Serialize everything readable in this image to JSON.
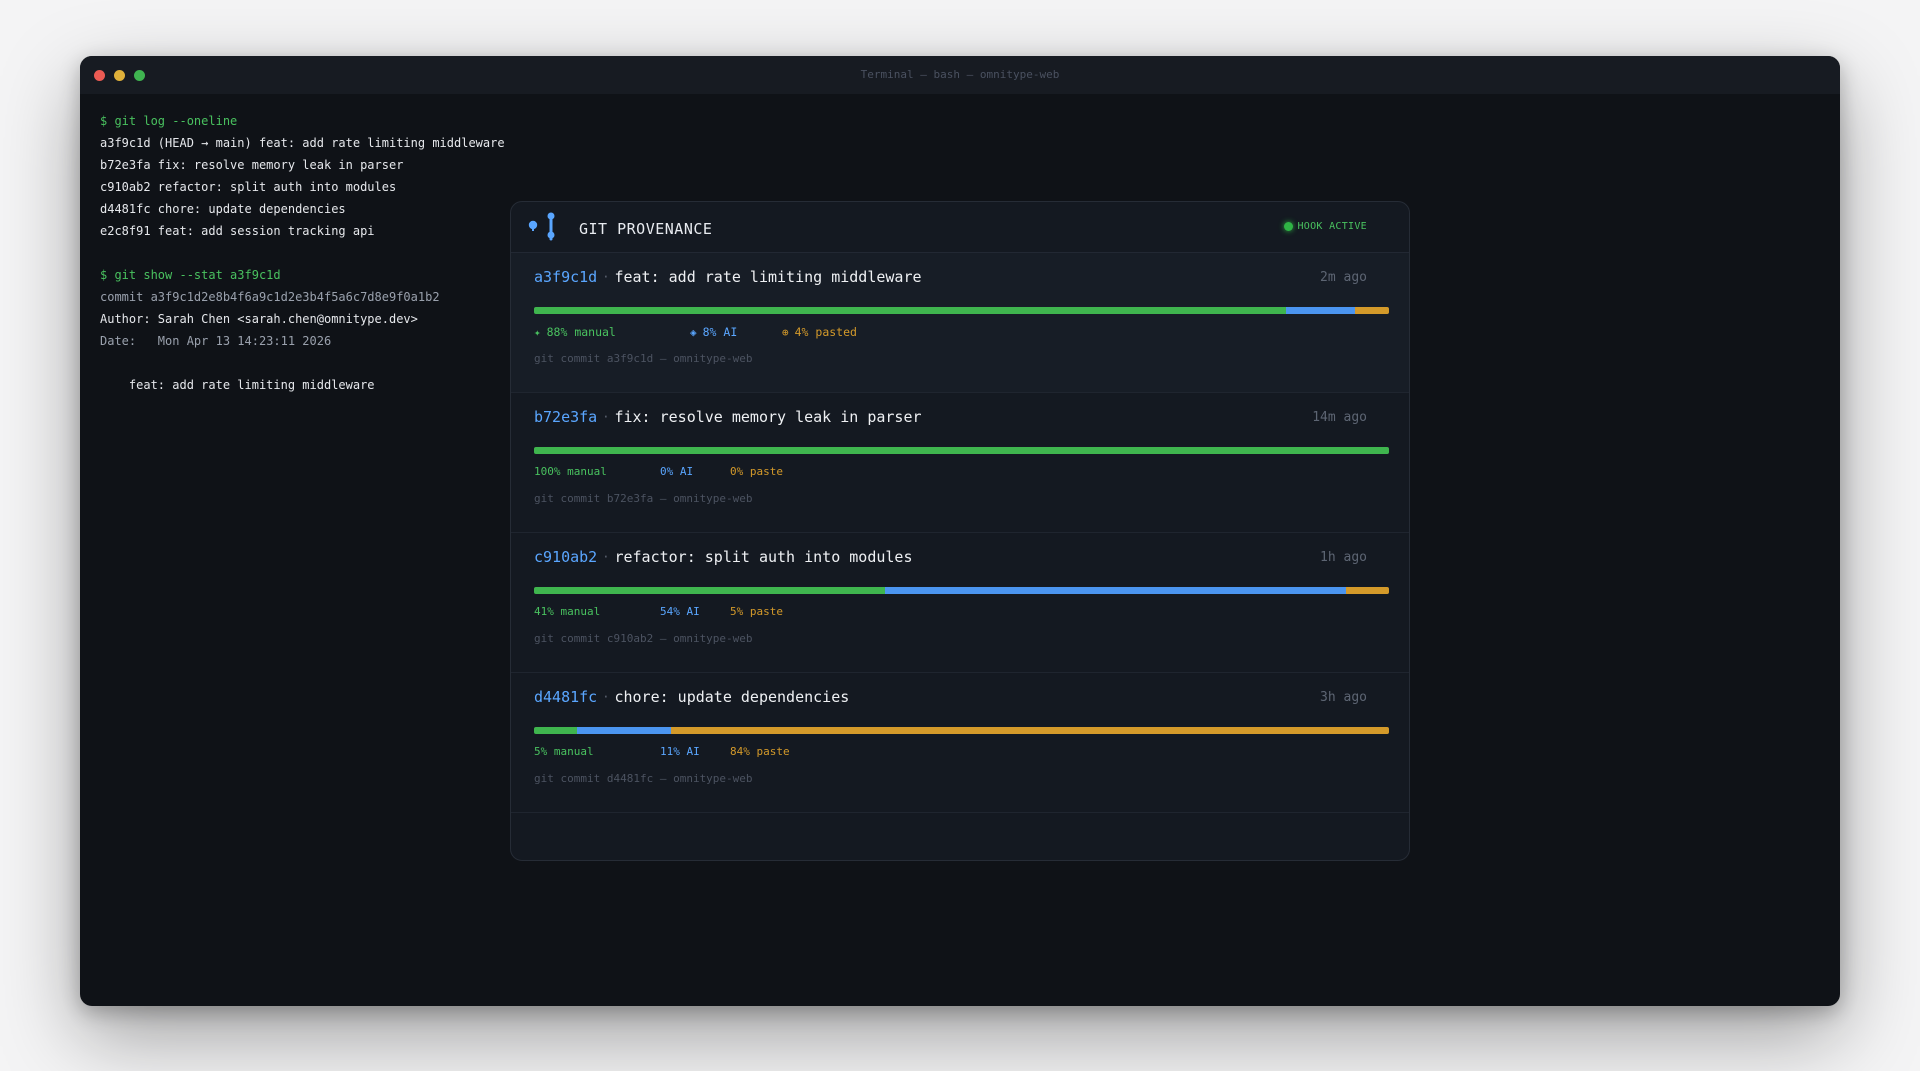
{
  "window": {
    "title": "Terminal — bash — omnitype-web"
  },
  "terminal": {
    "lines": [
      {
        "text": "$ git log --oneline",
        "kind": "prompt"
      },
      {
        "text": "a3f9c1d (HEAD → main) feat: add rate limiting middleware",
        "kind": "out"
      },
      {
        "text": "b72e3fa fix: resolve memory leak in parser",
        "kind": "out"
      },
      {
        "text": "c910ab2 refactor: split auth into modules",
        "kind": "out"
      },
      {
        "text": "d4481fc chore: update dependencies",
        "kind": "out"
      },
      {
        "text": "e2c8f91 feat: add session tracking api",
        "kind": "out"
      },
      {
        "text": "",
        "kind": "blank"
      },
      {
        "text": "$ git show --stat a3f9c1d",
        "kind": "prompt"
      },
      {
        "text": "commit a3f9c1d2e8b4f6a9c1d2e3b4f5a6c7d8e9f0a1b2",
        "kind": "dim"
      },
      {
        "text": "Author: Sarah Chen <sarah.chen@omnitype.dev>",
        "kind": "out"
      },
      {
        "text": "Date:   Mon Apr 13 14:23:11 2026",
        "kind": "dim"
      },
      {
        "text": "",
        "kind": "blank"
      },
      {
        "text": "    feat: add rate limiting middleware",
        "kind": "out"
      }
    ]
  },
  "panel": {
    "title": "GIT PROVENANCE",
    "hook_status": "HOOK ACTIVE",
    "icons": {
      "logo": "git-branch-icon",
      "hook": "status-dot-icon"
    },
    "colors": {
      "manual": "#3fb54e",
      "ai": "#4b95f0",
      "paste": "#d49a2a",
      "hash": "#5aa6ff"
    },
    "commits": [
      {
        "hash": "a3f9c1d",
        "separator": "·",
        "message": "feat: add rate limiting middleware",
        "time": "2m ago",
        "manual": 88,
        "ai": 8,
        "paste": 4,
        "manual_label": "88% manual",
        "ai_label": "8% AI",
        "paste_label": "4% pasted",
        "manual_icon": "✦",
        "ai_icon": "◈",
        "paste_icon": "⊕",
        "command": "git commit a3f9c1d — omnitype-web",
        "selected": true
      },
      {
        "hash": "b72e3fa",
        "separator": "·",
        "message": "fix: resolve memory leak in parser",
        "time": "14m ago",
        "manual": 100,
        "ai": 0,
        "paste": 0,
        "manual_label": "100% manual",
        "ai_label": "0% AI",
        "paste_label": "0% paste",
        "command": "git commit b72e3fa — omnitype-web",
        "selected": false
      },
      {
        "hash": "c910ab2",
        "separator": "·",
        "message": "refactor: split auth into modules",
        "time": "1h ago",
        "manual": 41,
        "ai": 54,
        "paste": 5,
        "manual_label": "41% manual",
        "ai_label": "54% AI",
        "paste_label": "5% paste",
        "command": "git commit c910ab2 — omnitype-web",
        "selected": false
      },
      {
        "hash": "d4481fc",
        "separator": "·",
        "message": "chore: update dependencies",
        "time": "3h ago",
        "manual": 5,
        "ai": 11,
        "paste": 84,
        "manual_label": "5% manual",
        "ai_label": "11% AI",
        "paste_label": "84% paste",
        "command": "git commit d4481fc — omnitype-web",
        "selected": false
      }
    ]
  }
}
